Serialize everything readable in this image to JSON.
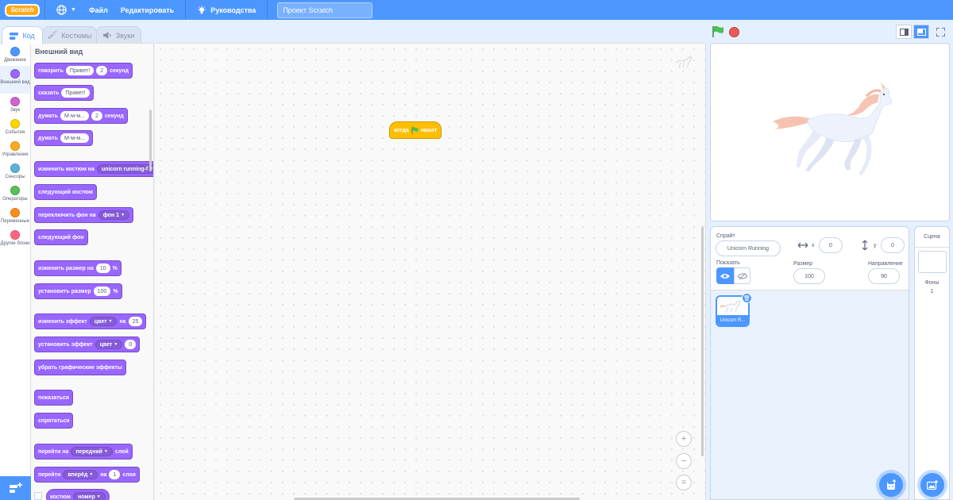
{
  "menu": {
    "logo": "Scratch",
    "file": "Файл",
    "edit": "Редактировать",
    "tutorials": "Руководства",
    "project_title": "Проект Scratch"
  },
  "tabs": [
    {
      "label": "Код",
      "icon": "code-icon"
    },
    {
      "label": "Костюмы",
      "icon": "brush-icon"
    },
    {
      "label": "Звуки",
      "icon": "speaker-icon"
    }
  ],
  "categories": [
    {
      "label": "Движение",
      "color": "#4c97ff"
    },
    {
      "label": "Внешний вид",
      "color": "#9966ff"
    },
    {
      "label": "Звук",
      "color": "#cf63cf"
    },
    {
      "label": "События",
      "color": "#ffd500"
    },
    {
      "label": "Управление",
      "color": "#ffab19"
    },
    {
      "label": "Сенсоры",
      "color": "#5cb1d6"
    },
    {
      "label": "Операторы",
      "color": "#59c059"
    },
    {
      "label": "Переменные",
      "color": "#ff8c1a"
    },
    {
      "label": "Другие блоки",
      "color": "#ff6680"
    }
  ],
  "palette": {
    "title": "Внешний вид",
    "say_secs": {
      "label": "говорить",
      "msg": "Привет!",
      "secs": "2",
      "unit": "секунд"
    },
    "say": {
      "label": "сказать",
      "msg": "Привет!"
    },
    "think_secs": {
      "label": "думать",
      "msg": "М-м-м...",
      "secs": "2",
      "unit": "секунд"
    },
    "think": {
      "label": "думать",
      "msg": "М-м-м..."
    },
    "switch_costume": {
      "label": "изменить костюм на",
      "value": "unicorn running-f"
    },
    "next_costume": "следующий костюм",
    "switch_backdrop": {
      "label": "переключить фон на",
      "value": "фон 1"
    },
    "next_backdrop": "следующий фон",
    "change_size": {
      "label": "изменить размер на",
      "value": "10",
      "unit": "%"
    },
    "set_size": {
      "label": "установить размер",
      "value": "100",
      "unit": "%"
    },
    "change_effect": {
      "label": "изменить эффект",
      "effect": "цвет",
      "mid": "на",
      "value": "25"
    },
    "set_effect": {
      "label": "установить эффект",
      "effect": "цвет",
      "value": "0"
    },
    "clear_effects": "убрать графические эффекты",
    "show": "показаться",
    "hide": "спрятаться",
    "go_to_layer": {
      "label": "перейти на",
      "value": "передний",
      "unit": "слой"
    },
    "go_layers": {
      "label": "перейти",
      "direction": "вперёд",
      "mid": "на",
      "value": "1",
      "unit": "слоя"
    },
    "costume_reporter": {
      "label": "костюм",
      "value": "номер"
    }
  },
  "workspace": {
    "hat_block": {
      "before": "когда",
      "after": "нажат"
    },
    "zoom_in": "+",
    "zoom_out": "−",
    "zoom_reset": "="
  },
  "sprite_info": {
    "sprite_label": "Спрайт",
    "sprite_name": "Unicorn Running",
    "x_label": "x",
    "x_value": "0",
    "y_label": "y",
    "y_value": "0",
    "show_label": "Показать",
    "size_label": "Размер",
    "size_value": "100",
    "direction_label": "Направление",
    "direction_value": "90"
  },
  "sprites": [
    {
      "name": "Unicorn R..."
    }
  ],
  "stage_pane": {
    "title": "Сцена",
    "backdrops_label": "Фоны",
    "backdrops_count": "1"
  },
  "colors": {
    "menu_blue": "#4c97ff",
    "looks_purple": "#9966ff",
    "events_yellow": "#ffbf00",
    "green_flag": "#4cbf56",
    "stop_red": "#ec5959"
  }
}
